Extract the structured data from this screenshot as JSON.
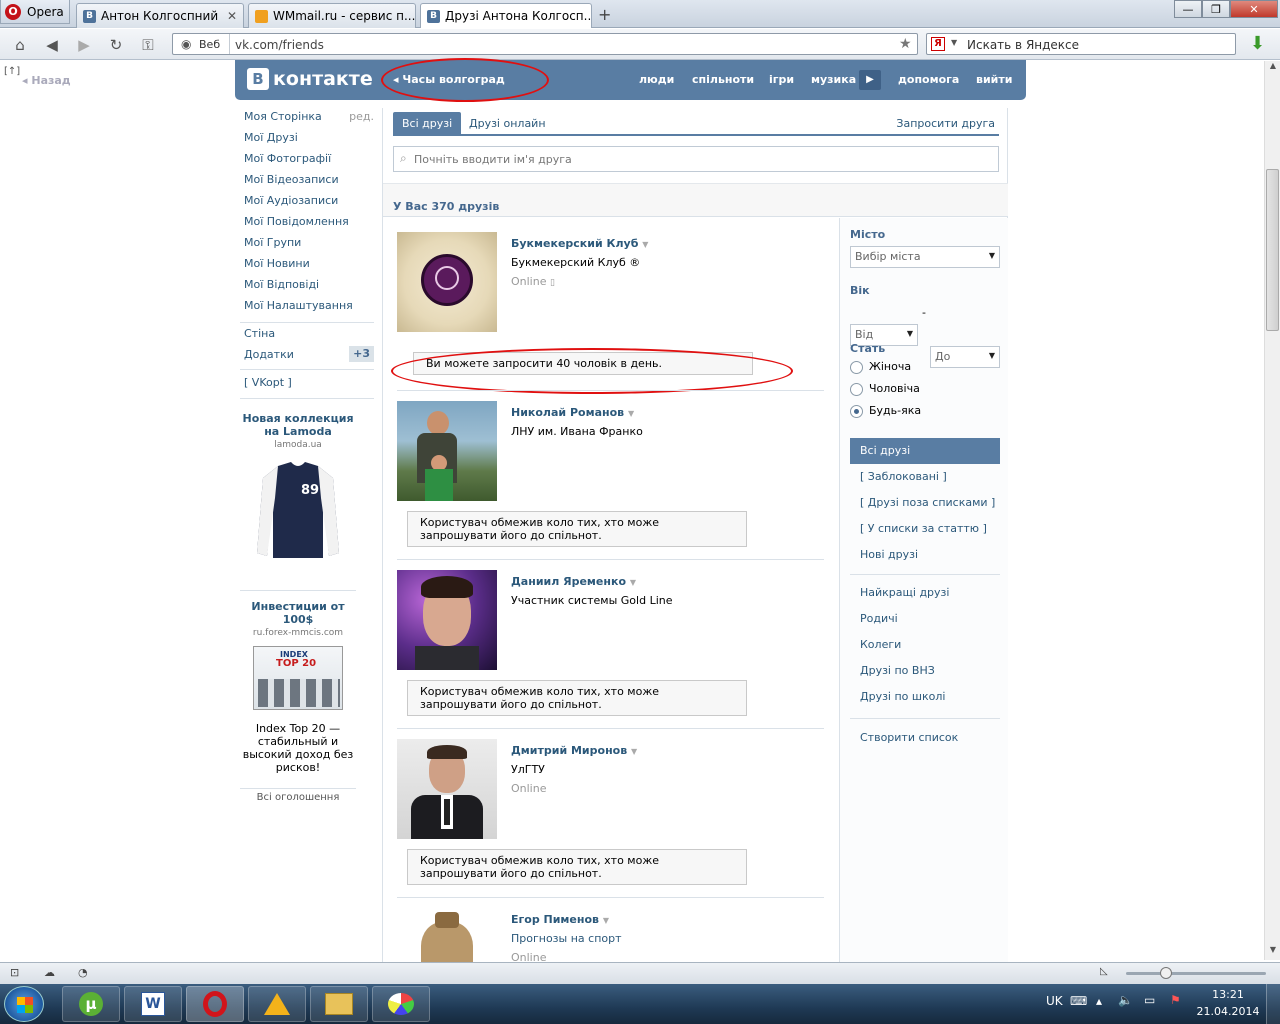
{
  "browser": {
    "menu_label": "Opera",
    "tabs": [
      {
        "title": "Антон Колгоспний"
      },
      {
        "title": "WMmail.ru - сервис п..."
      },
      {
        "title": "Друзі Антона Колгосп..."
      }
    ],
    "web_label": "Веб",
    "url": "vk.com/friends",
    "search_placeholder": "Искать в Яндексе",
    "back_label": "Назад",
    "side_marker": "[↑]"
  },
  "vk": {
    "logo": "контакте",
    "logo_letter": "В",
    "status": "Часы волгоград",
    "nav": [
      "люди",
      "спільноти",
      "ігри",
      "музика",
      "допомога",
      "вийти"
    ],
    "left_menu": [
      "Моя Сторінка",
      "Мої Друзі",
      "Мої Фотографії",
      "Мої Відеозаписи",
      "Мої Аудіозаписи",
      "Мої Повідомлення",
      "Мої Групи",
      "Мої Новини",
      "Мої Відповіді",
      "Мої Налаштування"
    ],
    "edit_label": "ред.",
    "left_menu2": [
      "Стіна",
      "Додатки"
    ],
    "apps_badge": "+3",
    "vkopt": "[ VKopt ]",
    "ads": [
      {
        "title": "Новая коллекция на Lamoda",
        "domain": "lamoda.ua"
      },
      {
        "title": "Инвестиции от 100$",
        "domain": "ru.forex-mmcis.com",
        "text": "Index Top 20 — стабильный и высокий доход без рисков!"
      }
    ],
    "all_ads": "Всі оголошення",
    "tab_all": "Всі друзі",
    "tab_online": "Друзі онлайн",
    "invite": "Запросити друга",
    "search_placeholder": "Почніть вводити ім'я друга",
    "count_label": "У Вас 370 друзів",
    "friends": [
      {
        "name": "Букмекерский Клуб",
        "info": "Букмекерский Клуб ®",
        "online": "Online"
      },
      {
        "name": "Николай Романов",
        "info": "ЛНУ им. Ивана Франко",
        "online": ""
      },
      {
        "name": "Даниил Яременко",
        "info": "Участник системы Gold Line",
        "online": ""
      },
      {
        "name": "Дмитрий Миронов",
        "info": "УлГТУ",
        "online": "Online"
      },
      {
        "name": "Егор Пименов",
        "info": "Прогнозы на спорт",
        "online": "Online"
      }
    ],
    "notes": [
      "Ви можете запросити 40 чоловік в день.",
      "Користувач обмежив коло тих, хто може запрошувати його до спільнот."
    ],
    "filter": {
      "city_label": "Місто",
      "city_value": "Вибір міста",
      "age_label": "Вік",
      "age_from": "Від",
      "age_to": "До",
      "dash": "-",
      "sex_label": "Стать",
      "sex": [
        "Жіноча",
        "Чоловіча",
        "Будь-яка"
      ]
    },
    "lists": [
      "Всі друзі",
      "[ Заблоковані ]",
      "[ Друзі поза списками ]",
      "[ У списки за статтю ]",
      "Нові друзі"
    ],
    "lists2": [
      "Найкращі друзі",
      "Родичі",
      "Колеги",
      "Друзі по ВНЗ",
      "Друзі по школі"
    ],
    "create_list": "Створити список"
  },
  "taskbar": {
    "lang": "UK",
    "time": "13:21",
    "date": "21.04.2014"
  }
}
